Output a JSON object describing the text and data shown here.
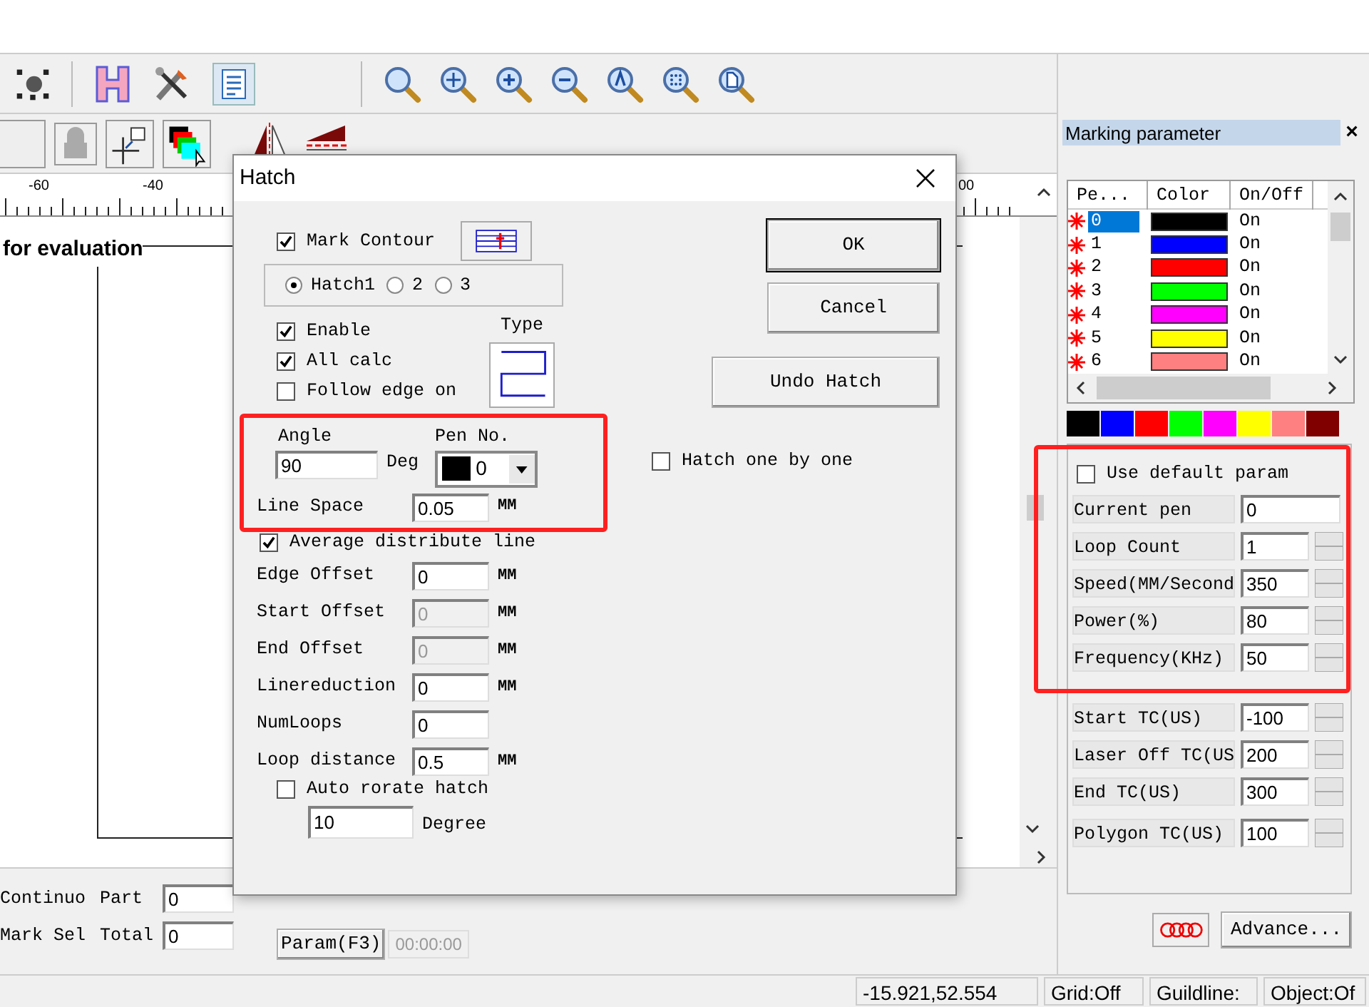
{
  "ruler": {
    "labels": [
      "-60",
      "-40",
      "00"
    ]
  },
  "canvas": {
    "text": "for evaluation"
  },
  "bottom_panel": {
    "checks": [
      {
        "label": "Continuo"
      },
      {
        "label": "Mark Sel"
      }
    ],
    "counters": [
      {
        "label": "Part",
        "value": "0"
      },
      {
        "label": "Total",
        "value": "0"
      }
    ],
    "param_button": "Param(F3)",
    "timer": "00:00:00"
  },
  "status_bar": [
    "-15.921,52.554",
    "Grid:Off",
    "Guildline:",
    "Object:Of"
  ],
  "dialog": {
    "title": "Hatch",
    "mark_contour": {
      "label": "Mark Contour",
      "checked": true
    },
    "hatch_options": [
      {
        "label": "Hatch1",
        "selected": true
      },
      {
        "label": "2",
        "selected": false
      },
      {
        "label": "3",
        "selected": false
      }
    ],
    "options": [
      {
        "label": "Enable",
        "checked": true
      },
      {
        "label": "All calc",
        "checked": true
      },
      {
        "label": "Follow edge on",
        "checked": false
      }
    ],
    "type_label": "Type",
    "angle": {
      "label": "Angle",
      "value": "90",
      "unit": "Deg"
    },
    "pen": {
      "label": "Pen No.",
      "value": "0",
      "color": "#000000"
    },
    "line_space": {
      "label": "Line Space",
      "value": "0.05",
      "unit": "MM"
    },
    "average": {
      "label": "Average distribute line",
      "checked": true
    },
    "fields": [
      {
        "label": "Edge Offset",
        "value": "0",
        "unit": "MM",
        "disabled": false
      },
      {
        "label": "Start Offset",
        "value": "0",
        "unit": "MM",
        "disabled": true
      },
      {
        "label": "End Offset",
        "value": "0",
        "unit": "MM",
        "disabled": true
      },
      {
        "label": "Linereduction",
        "value": "0",
        "unit": "MM",
        "disabled": false
      },
      {
        "label": "NumLoops",
        "value": "0",
        "disabled": false
      },
      {
        "label": "Loop distance",
        "value": "0.5",
        "unit": "MM",
        "disabled": false
      }
    ],
    "auto_rotate": {
      "label": "Auto rorate hatch",
      "checked": false
    },
    "degree": {
      "value": "10",
      "unit": "Degree"
    },
    "buttons": [
      "OK",
      "Cancel",
      "Undo Hatch"
    ],
    "one_by_one": {
      "label": "Hatch one by one",
      "checked": false
    }
  },
  "marking_panel": {
    "title": "Marking parameter",
    "close": "×",
    "columns": [
      "Pe...",
      "Color",
      "On/Off"
    ],
    "pens": [
      {
        "pen": "0",
        "color": "#000000",
        "state": "On",
        "selected": true
      },
      {
        "pen": "1",
        "color": "#0000ff",
        "state": "On",
        "selected": false
      },
      {
        "pen": "2",
        "color": "#ff0000",
        "state": "On",
        "selected": false
      },
      {
        "pen": "3",
        "color": "#00ff00",
        "state": "On",
        "selected": false
      },
      {
        "pen": "4",
        "color": "#ff00ff",
        "state": "On",
        "selected": false
      },
      {
        "pen": "5",
        "color": "#ffff00",
        "state": "On",
        "selected": false
      },
      {
        "pen": "6",
        "color": "#ff8080",
        "state": "On",
        "selected": false
      }
    ],
    "palette": [
      {
        "color": "#000000"
      },
      {
        "color": "#0000ff"
      },
      {
        "color": "#ff0000"
      },
      {
        "color": "#00ff00"
      },
      {
        "color": "#ff00ff"
      },
      {
        "color": "#ffff00"
      },
      {
        "color": "#ff8080"
      },
      {
        "color": "#800000"
      }
    ],
    "use_default": {
      "label": "Use default param",
      "checked": false
    },
    "param_groups": [
      {
        "items": [
          {
            "label": "Current pen",
            "value": "0",
            "kind": "plain"
          },
          {
            "label": "Loop Count",
            "value": "1",
            "kind": "spin"
          },
          {
            "label": "Speed(MM/Second",
            "value": "350",
            "kind": "spin"
          },
          {
            "label": "Power(%)",
            "value": "80",
            "kind": "spin"
          },
          {
            "label": "Frequency(KHz)",
            "value": "50",
            "kind": "spin"
          }
        ]
      },
      {
        "items": [
          {
            "label": "Start TC(US)",
            "value": "-100",
            "kind": "spin"
          },
          {
            "label": "Laser Off TC(US",
            "value": "200",
            "kind": "spin"
          },
          {
            "label": "End TC(US)",
            "value": "300",
            "kind": "spin"
          }
        ]
      },
      {
        "items": [
          {
            "label": "Polygon TC(US)",
            "value": "100",
            "kind": "spin"
          }
        ]
      }
    ],
    "advance": "Advance..."
  }
}
